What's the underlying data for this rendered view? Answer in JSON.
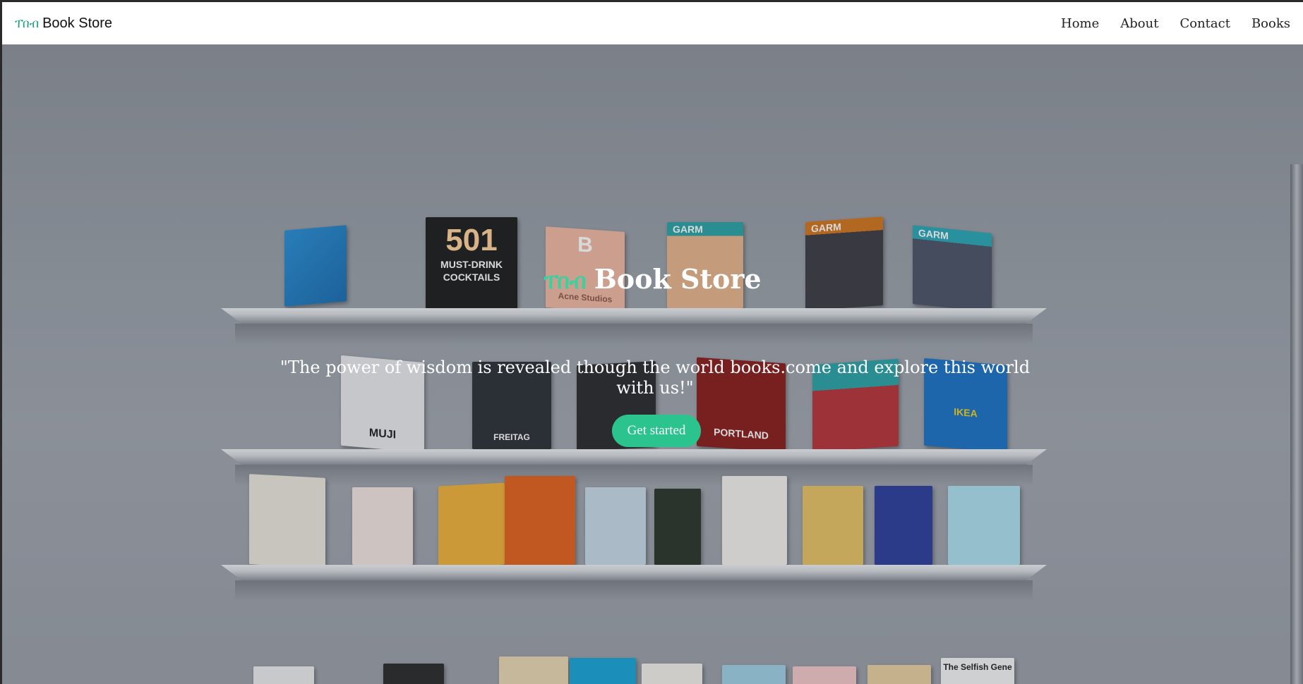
{
  "navbar": {
    "brand_mark": "ፐበብ",
    "brand_text": "Book Store",
    "links": [
      "Home",
      "About",
      "Contact",
      "Books"
    ]
  },
  "hero": {
    "title_mark": "ፐበብ",
    "title_text": "Book Store",
    "quote": "\"The power of wisdom is revealed though the world books.come and explore this world with us!\"",
    "cta_label": "Get started"
  },
  "books_visible_titles": {
    "b1": "501",
    "b1_sub": "MUST-DRINK COCKTAILS",
    "b2": "B",
    "b2_sub": "Acne Studios",
    "garm": "GARM",
    "muji": "MUJI",
    "freitag": "FREITAG",
    "portland": "PORTLAND",
    "ikea": "IKEA",
    "selfish": "The Selfish Gene"
  },
  "colors": {
    "accent": "#2bc48f",
    "brand_green": "#1aa37a"
  }
}
